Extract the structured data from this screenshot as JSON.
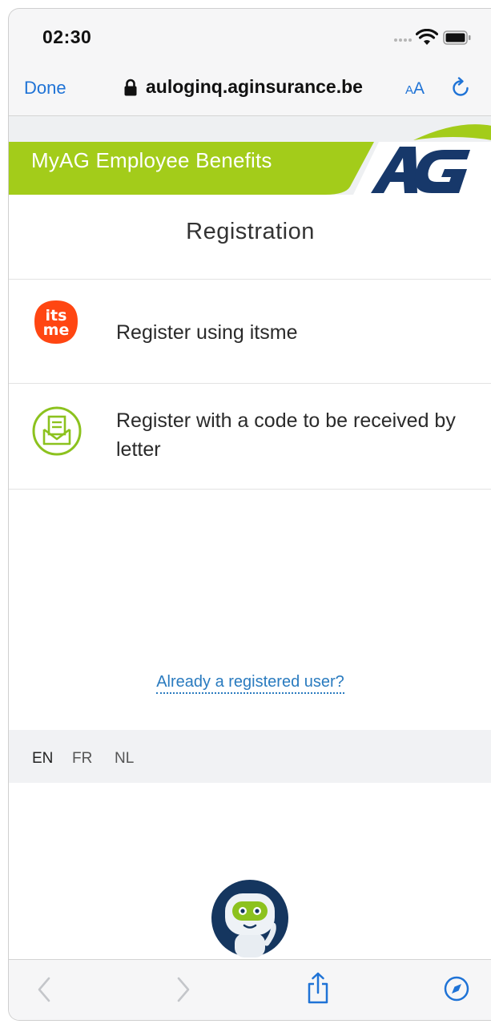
{
  "status_bar": {
    "time": "02:30"
  },
  "browser": {
    "done_label": "Done",
    "url": "auloginq.aginsurance.be",
    "text_size_small": "A",
    "text_size_big": "A"
  },
  "brand": {
    "title": "MyAG Employee Benefits",
    "logo_text": "AG",
    "accent_color": "#a3cc1a",
    "logo_color": "#17386a"
  },
  "page": {
    "title": "Registration",
    "options": [
      {
        "label": "Register using itsme",
        "icon": "itsme-logo"
      },
      {
        "label": "Register with a code to be received by letter",
        "icon": "letter-icon"
      }
    ],
    "itsme_logo_text": [
      "its",
      "me"
    ],
    "already_registered_link": "Already a registered user?"
  },
  "languages": [
    {
      "code": "EN",
      "active": true
    },
    {
      "code": "FR",
      "active": false
    },
    {
      "code": "NL",
      "active": false
    }
  ],
  "toolbar": {
    "icons": [
      "back-icon",
      "forward-icon",
      "share-icon",
      "compass-icon"
    ]
  },
  "chatbot": {
    "icon": "robot-assistant-icon"
  }
}
